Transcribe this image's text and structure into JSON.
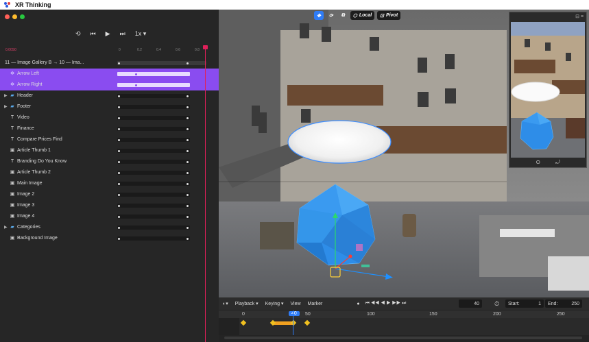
{
  "app": {
    "title": "XR Thinking"
  },
  "transport": {
    "loop": "⟲",
    "prev": "⏮",
    "play": "▶",
    "next": "⏭",
    "speed": "1x ▾"
  },
  "ruler": {
    "label": "0.00S0",
    "ticks": [
      "0",
      "0.2",
      "0.4",
      "0.6",
      "0.8"
    ]
  },
  "layers": [
    {
      "label": "11 — Image Gallery B → 10 — Ima...",
      "type": "group-header"
    },
    {
      "label": "Arrow Left",
      "icon": "gear-icon",
      "selected": true
    },
    {
      "label": "Arrow Right",
      "icon": "gear-icon",
      "selected": true
    },
    {
      "label": "Header",
      "icon": "folder-icon",
      "caret": true
    },
    {
      "label": "Footer",
      "icon": "folder-icon",
      "caret": true
    },
    {
      "label": "Video",
      "icon": "text-icon"
    },
    {
      "label": "Finance",
      "icon": "text-icon"
    },
    {
      "label": "Compare Prices Find",
      "icon": "text-icon"
    },
    {
      "label": "Article Thumb 1",
      "icon": "image-icon"
    },
    {
      "label": "Branding Do You Know",
      "icon": "text-icon"
    },
    {
      "label": "Article Thumb 2",
      "icon": "image-icon"
    },
    {
      "label": "Main Image",
      "icon": "image-icon"
    },
    {
      "label": "Image 2",
      "icon": "image-icon"
    },
    {
      "label": "Image 3",
      "icon": "image-icon"
    },
    {
      "label": "Image 4",
      "icon": "image-icon"
    },
    {
      "label": "Categories",
      "icon": "folder-icon",
      "caret": true
    },
    {
      "label": "Background Image",
      "icon": "image-icon"
    }
  ],
  "viewport": {
    "local": "Local",
    "pivot": "Pivot"
  },
  "timeline": {
    "menu": [
      "Playback ▾",
      "Keying ▾",
      "View",
      "Marker"
    ],
    "current_frame": "40",
    "start_label": "Start:",
    "start": "1",
    "end_label": "End:",
    "end": "250",
    "frame_marks": [
      "0",
      "40",
      "50",
      "100",
      "150",
      "200",
      "250"
    ]
  },
  "colors": {
    "accent": "#8a4cf0",
    "playhead": "#e0205a",
    "blue": "#2f7cf6",
    "key": "#f0a020"
  }
}
